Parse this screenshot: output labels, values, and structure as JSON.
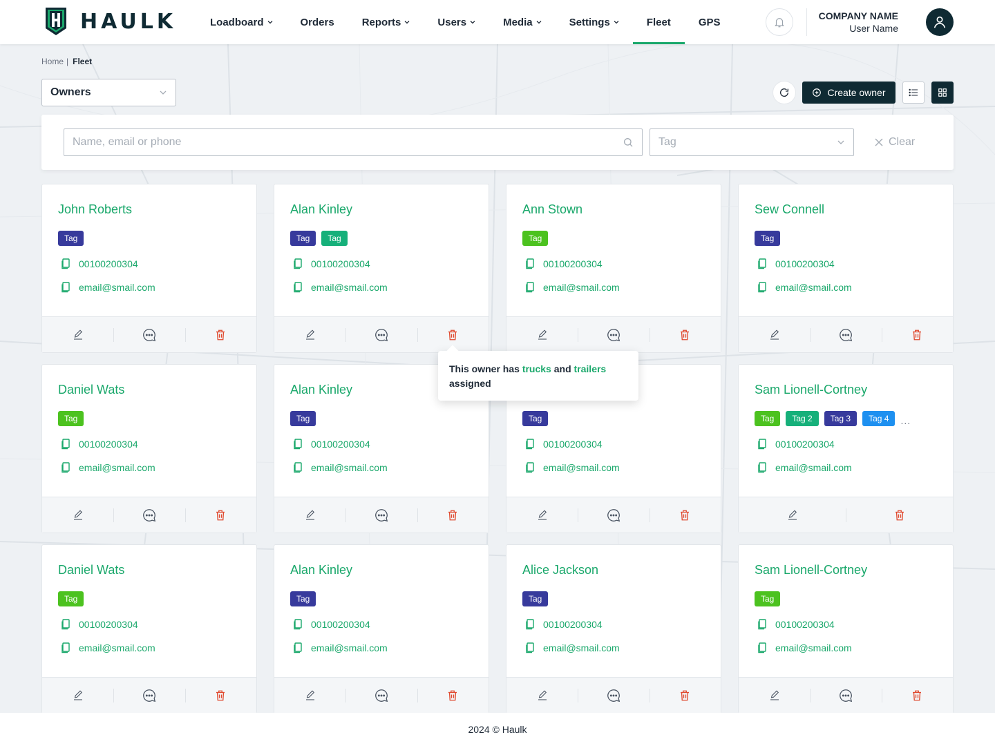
{
  "app": {
    "brand": "HAULK",
    "brand_color": "#0f2a33",
    "accent_color": "#1aa86b"
  },
  "header": {
    "nav": [
      {
        "label": "Loadboard",
        "dropdown": true,
        "active": false
      },
      {
        "label": "Orders",
        "dropdown": false,
        "active": false
      },
      {
        "label": "Reports",
        "dropdown": true,
        "active": false
      },
      {
        "label": "Users",
        "dropdown": true,
        "active": false
      },
      {
        "label": "Media",
        "dropdown": true,
        "active": false
      },
      {
        "label": "Settings",
        "dropdown": true,
        "active": false
      },
      {
        "label": "Fleet",
        "dropdown": false,
        "active": true
      },
      {
        "label": "GPS",
        "dropdown": false,
        "active": false
      }
    ],
    "company_name": "COMPANY NAME",
    "user_name": "User Name",
    "icons": {
      "bell": "bell-icon",
      "avatar": "user-avatar-icon"
    }
  },
  "breadcrumb": {
    "home": "Home",
    "separator": "|",
    "current": "Fleet"
  },
  "toolbar": {
    "owners_select": "Owners",
    "create_label": "Create owner"
  },
  "filters": {
    "search_placeholder": "Name, email or phone",
    "tag_placeholder": "Tag",
    "clear_label": "Clear"
  },
  "tooltip": {
    "text_before": "This owner has ",
    "trucks": "trucks",
    "middle": " and ",
    "trailers": "trailers",
    "text_after": " assigned"
  },
  "owners": [
    {
      "name": "John Roberts",
      "tags": [
        {
          "label": "Tag",
          "color": "navy"
        }
      ],
      "phone": "00100200304",
      "email": "email@smail.com",
      "actions": [
        "edit",
        "comment",
        "delete"
      ]
    },
    {
      "name": "Alan Kinley",
      "tags": [
        {
          "label": "Tag",
          "color": "navy"
        },
        {
          "label": "Tag",
          "color": "green"
        }
      ],
      "phone": "00100200304",
      "email": "email@smail.com",
      "actions": [
        "edit",
        "comment",
        "delete"
      ]
    },
    {
      "name": "Ann Stown",
      "tags": [
        {
          "label": "Tag",
          "color": "lime"
        }
      ],
      "phone": "00100200304",
      "email": "email@smail.com",
      "actions": [
        "edit",
        "comment",
        "delete"
      ]
    },
    {
      "name": "Sew Connell",
      "tags": [
        {
          "label": "Tag",
          "color": "navy"
        }
      ],
      "phone": "00100200304",
      "email": "email@smail.com",
      "actions": [
        "edit",
        "comment",
        "delete"
      ]
    },
    {
      "name": "Daniel Wats",
      "tags": [
        {
          "label": "Tag",
          "color": "lime"
        }
      ],
      "phone": "00100200304",
      "email": "email@smail.com",
      "actions": [
        "edit",
        "comment",
        "delete"
      ]
    },
    {
      "name": "Alan Kinley",
      "tags": [
        {
          "label": "Tag",
          "color": "navy"
        }
      ],
      "phone": "00100200304",
      "email": "email@smail.com",
      "actions": [
        "edit",
        "comment",
        "delete"
      ]
    },
    {
      "name": "",
      "tags": [
        {
          "label": "Tag",
          "color": "navy"
        }
      ],
      "phone": "00100200304",
      "email": "email@smail.com",
      "actions": [
        "edit",
        "comment",
        "delete"
      ]
    },
    {
      "name": "Sam Lionell-Cortney",
      "tags": [
        {
          "label": "Tag",
          "color": "lime"
        },
        {
          "label": "Tag 2",
          "color": "green"
        },
        {
          "label": "Tag 3",
          "color": "navy"
        },
        {
          "label": "Tag 4",
          "color": "blue"
        }
      ],
      "more": "...",
      "phone": "00100200304",
      "email": "email@smail.com",
      "actions": [
        "edit",
        "delete"
      ]
    },
    {
      "name": "Daniel Wats",
      "tags": [
        {
          "label": "Tag",
          "color": "lime"
        }
      ],
      "phone": "00100200304",
      "email": "email@smail.com",
      "actions": [
        "edit",
        "comment",
        "delete"
      ]
    },
    {
      "name": "Alan Kinley",
      "tags": [
        {
          "label": "Tag",
          "color": "navy"
        }
      ],
      "phone": "00100200304",
      "email": "email@smail.com",
      "actions": [
        "edit",
        "comment",
        "delete"
      ]
    },
    {
      "name": "Alice Jackson",
      "tags": [
        {
          "label": "Tag",
          "color": "navy"
        }
      ],
      "phone": "00100200304",
      "email": "email@smail.com",
      "actions": [
        "edit",
        "comment",
        "delete"
      ]
    },
    {
      "name": "Sam Lionell-Cortney",
      "tags": [
        {
          "label": "Tag",
          "color": "lime"
        }
      ],
      "phone": "00100200304",
      "email": "email@smail.com",
      "actions": [
        "edit",
        "comment",
        "delete"
      ]
    }
  ],
  "footer": {
    "text": "2024 © Haulk"
  }
}
